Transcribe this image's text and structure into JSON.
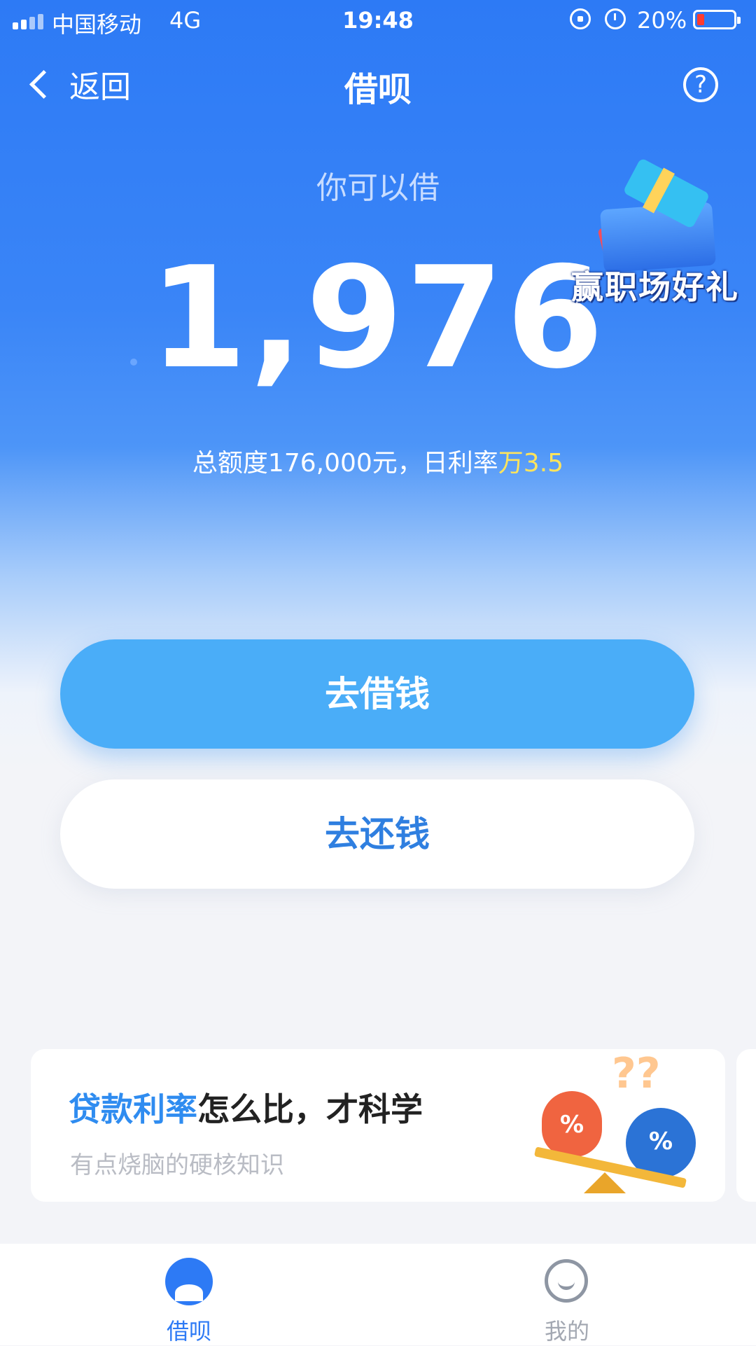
{
  "status_bar": {
    "carrier": "中国移动",
    "network": "4G",
    "time": "19:48",
    "battery": "20%",
    "battery_level": 0.2
  },
  "nav": {
    "back_label": "返回",
    "title": "借呗",
    "help_symbol": "?"
  },
  "hero": {
    "subtitle": "你可以借",
    "amount": "1,976",
    "quota_text": "总额度176,000元，日利率",
    "rate_text": "万3.5"
  },
  "promo": {
    "text": "赢职场好礼"
  },
  "actions": {
    "borrow_label": "去借钱",
    "repay_label": "去还钱"
  },
  "article": {
    "title_highlight": "贷款利率",
    "title_rest": "怎么比，才科学",
    "subtitle": "有点烧脑的硬核知识",
    "illustration_symbol": "%",
    "question_marks": "?‍?"
  },
  "tabs": [
    {
      "label": "借呗",
      "icon": "jiebei-shell-icon",
      "active": true
    },
    {
      "label": "我的",
      "icon": "smiley-icon",
      "active": false
    }
  ],
  "colors": {
    "primary": "#2d7af5",
    "borrow_button": "#4aadf8",
    "rate_highlight": "#ffe45c",
    "article_highlight": "#2f8cf0"
  }
}
